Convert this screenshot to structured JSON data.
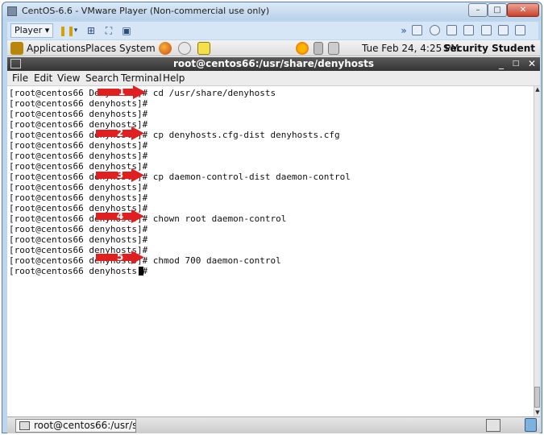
{
  "vmware": {
    "title": "CentOS-6.6 - VMware Player (Non-commercial use only)",
    "player_menu": "Player",
    "min": "–",
    "max": "□",
    "close": "✕"
  },
  "guest_panel": {
    "applications": "Applications",
    "places": "Places",
    "system": "System",
    "clock": "Tue Feb 24,  4:25 PM",
    "user": "Security Student"
  },
  "terminal": {
    "title": "root@centos66:/usr/share/denyhosts",
    "menu": [
      "File",
      "Edit",
      "View",
      "Search",
      "Terminal",
      "Help"
    ],
    "lines": [
      "[root@centos66 DenyHosts]# cd /usr/share/denyhosts",
      "[root@centos66 denyhosts]#",
      "[root@centos66 denyhosts]#",
      "[root@centos66 denyhosts]#",
      "[root@centos66 denyhosts]# cp denyhosts.cfg-dist denyhosts.cfg",
      "[root@centos66 denyhosts]#",
      "[root@centos66 denyhosts]#",
      "[root@centos66 denyhosts]#",
      "[root@centos66 denyhosts]# cp daemon-control-dist daemon-control",
      "[root@centos66 denyhosts]#",
      "[root@centos66 denyhosts]#",
      "[root@centos66 denyhosts]#",
      "[root@centos66 denyhosts]# chown root daemon-control",
      "[root@centos66 denyhosts]#",
      "[root@centos66 denyhosts]#",
      "[root@centos66 denyhosts]#",
      "[root@centos66 denyhosts]# chmod 700 daemon-control",
      "[root@centos66 denyhosts]# "
    ],
    "callouts": [
      "1",
      "2",
      "3",
      "4",
      "5"
    ]
  },
  "taskbar": {
    "item": "root@centos66:/usr/sh..."
  },
  "colors": {
    "callout": "#e02020",
    "terminal_title": "#3c3c3c"
  },
  "icons": [
    "firefox-icon",
    "email-icon",
    "notes-icon",
    "network-icon",
    "volume-icon",
    "weather-icon",
    "trash-icon",
    "workspace-icon"
  ]
}
